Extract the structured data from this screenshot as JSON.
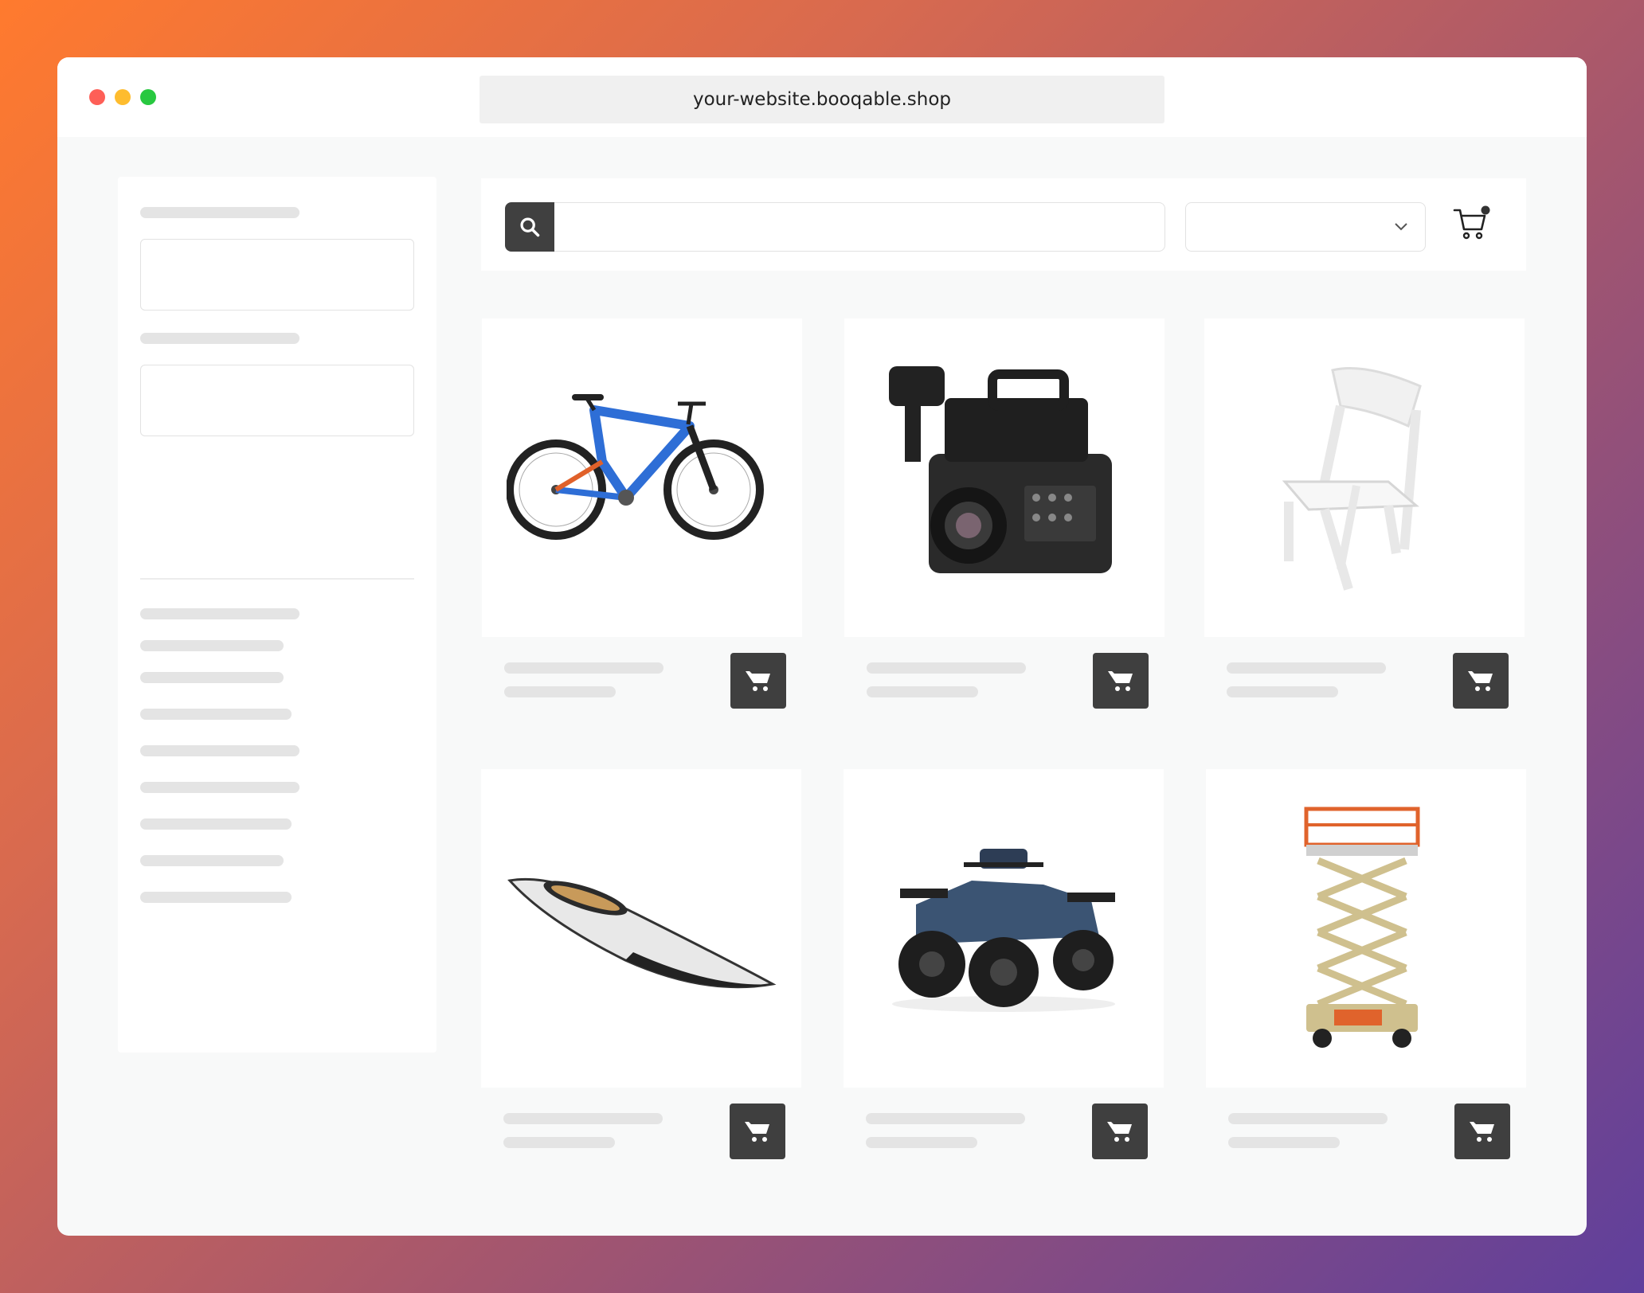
{
  "browser": {
    "url": "your-website.booqable.shop"
  },
  "icons": {
    "search": "search-icon",
    "cart": "shopping-cart-icon",
    "chevron": "chevron-down-icon",
    "add_to_cart": "shopping-cart-icon"
  },
  "products": [
    {
      "image": "mountain-bike"
    },
    {
      "image": "sony-cinema-camera"
    },
    {
      "image": "white-folding-chair"
    },
    {
      "image": "kayak"
    },
    {
      "image": "atv-quad"
    },
    {
      "image": "scissor-lift"
    }
  ],
  "colors": {
    "accent_dark": "#3f3f3f",
    "skeleton": "#e4e4e4",
    "gradient_start": "#ff7a2e",
    "gradient_end": "#5f3f9c"
  }
}
